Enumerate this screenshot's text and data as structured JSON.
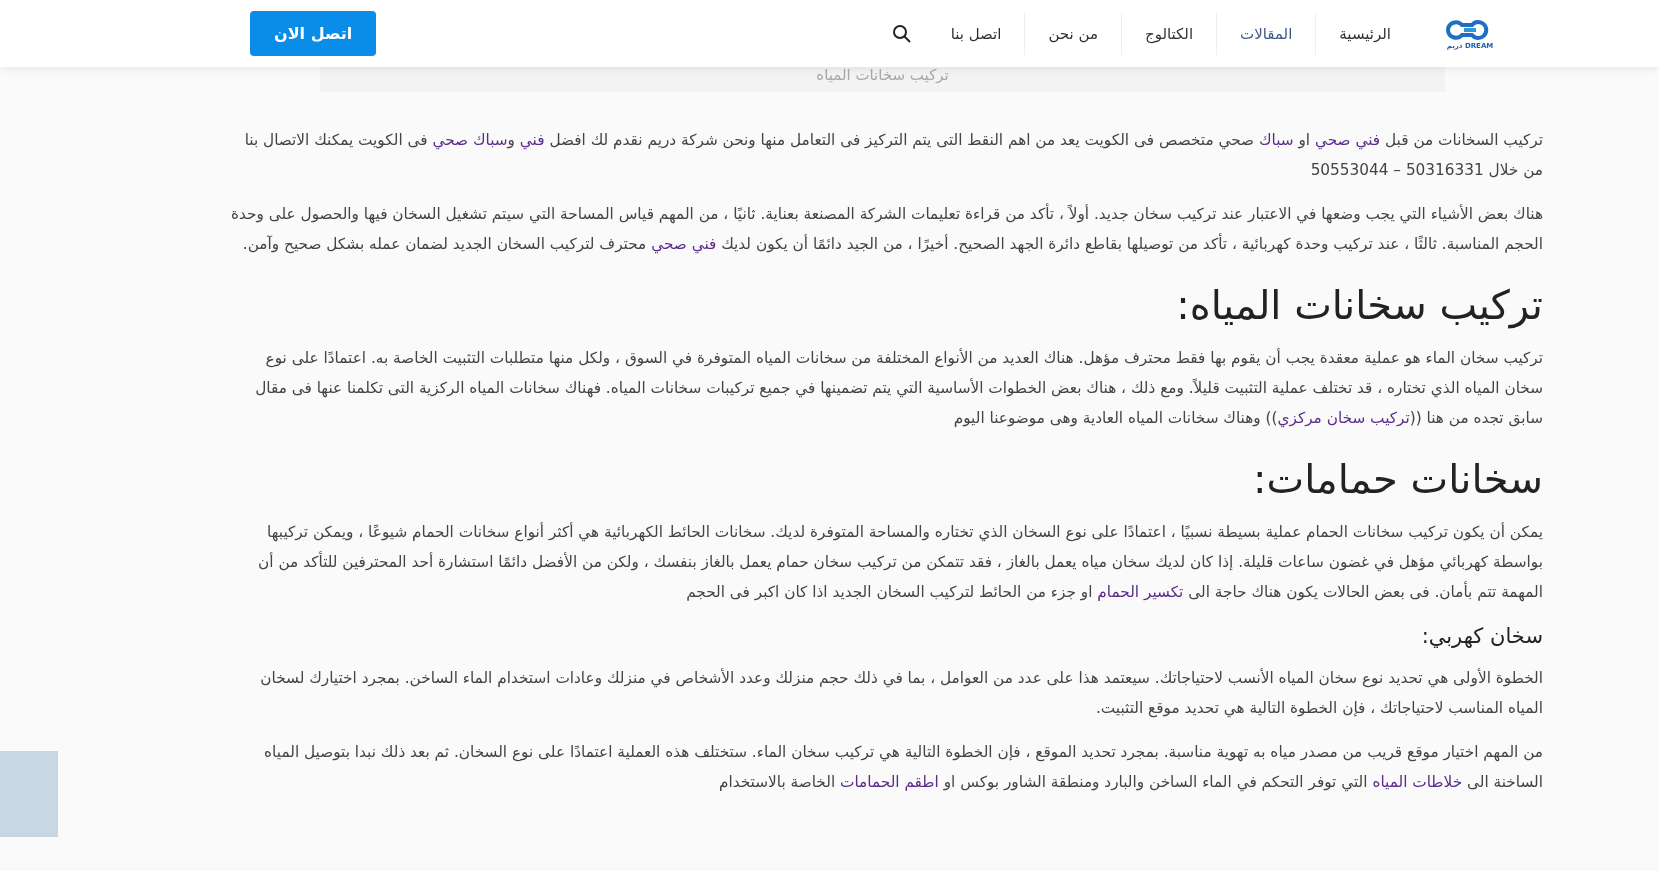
{
  "header": {
    "logo_text": "DREAM دريم",
    "nav": [
      {
        "label": "الرئيسية",
        "selected": false
      },
      {
        "label": "المقالات",
        "selected": true
      },
      {
        "label": "الكتالوج",
        "selected": false
      },
      {
        "label": "من نحن",
        "selected": false
      },
      {
        "label": "اتصل بنا",
        "selected": false
      }
    ],
    "cta": "اتصل الان"
  },
  "caption": "تركيب سخانات المياه",
  "blocks": [
    {
      "kind": "p",
      "segments": [
        {
          "text": "تركيب السخانات من قبل ",
          "link": false
        },
        {
          "text": "فني صحي",
          "link": true
        },
        {
          "text": " او ",
          "link": false
        },
        {
          "text": "سباك",
          "link": true
        },
        {
          "text": " صحي متخصص فى الكويت يعد من اهم النقط التى يتم التركيز فى التعامل منها ونحن شركة دريم نقدم لك افضل ",
          "link": false
        },
        {
          "text": "فني",
          "link": true
        },
        {
          "text": " و",
          "link": false
        },
        {
          "text": "سباك صحي",
          "link": true
        },
        {
          "text": " فى الكويت يمكنك الاتصال بنا من خلال 50316331 – 50553044",
          "link": false
        }
      ]
    },
    {
      "kind": "p",
      "segments": [
        {
          "text": "هناك بعض الأشياء التي يجب وضعها في الاعتبار عند تركيب سخان جديد. أولاً ، تأكد من قراءة تعليمات الشركة المصنعة بعناية. ثانيًا ، من المهم قياس المساحة التي سيتم تشغيل السخان فيها والحصول على وحدة الحجم المناسبة. ثالثًا ، عند تركيب وحدة كهربائية ، تأكد من توصيلها بقاطع دائرة الجهد الصحيح. أخيرًا ، من الجيد دائمًا أن يكون لديك ",
          "link": false
        },
        {
          "text": "فني صحي",
          "link": true
        },
        {
          "text": " محترف لتركيب السخان الجديد لضمان عمله بشكل صحيح وآمن.",
          "link": false
        }
      ]
    },
    {
      "kind": "h2",
      "segments": [
        {
          "text": "تركيب سخانات المياه:",
          "link": false
        }
      ]
    },
    {
      "kind": "p",
      "segments": [
        {
          "text": "تركيب سخان الماء هو عملية معقدة يجب أن يقوم بها فقط محترف مؤهل. هناك العديد من الأنواع المختلفة من سخانات المياه المتوفرة في السوق ، ولكل منها متطلبات التثبيت الخاصة به. اعتمادًا على نوع سخان المياه الذي تختاره ، قد تختلف عملية التثبيت قليلاً. ومع ذلك ، هناك بعض الخطوات الأساسية التي يتم تضمينها في جميع تركيبات سخانات المياه. فهناك سخانات المياه الركزية التى تكلمنا عنها فى مقال سابق تجده من هنا ((",
          "link": false
        },
        {
          "text": "تركيب سخان مركزي",
          "link": true
        },
        {
          "text": ")) وهناك سخانات المياه العادية وهى موضوعنا اليوم",
          "link": false
        }
      ]
    },
    {
      "kind": "h2",
      "segments": [
        {
          "text": "سخانات حمامات:",
          "link": false
        }
      ]
    },
    {
      "kind": "p",
      "segments": [
        {
          "text": "يمكن أن يكون تركيب سخانات الحمام عملية بسيطة نسبيًا ، اعتمادًا على نوع السخان الذي تختاره والمساحة المتوفرة لديك. سخانات الحائط الكهربائية هي أكثر أنواع سخانات الحمام شيوعًا ، ويمكن تركيبها بواسطة كهربائي مؤهل في غضون ساعات قليلة. إذا كان لديك سخان مياه يعمل بالغاز ، فقد تتمكن من تركيب سخان حمام يعمل بالغاز بنفسك ، ولكن من الأفضل دائمًا استشارة أحد المحترفين للتأكد من أن المهمة تتم بأمان. فى بعض الحالات يكون هناك حاجة الى ",
          "link": false
        },
        {
          "text": "تكسير الحمام",
          "link": true
        },
        {
          "text": " او جزء من الحائط لتركيب السخان الجديد اذا كان اكبر فى الحجم",
          "link": false
        }
      ]
    },
    {
      "kind": "h3",
      "segments": [
        {
          "text": "سخان كهربي:",
          "link": false
        }
      ]
    },
    {
      "kind": "p",
      "segments": [
        {
          "text": "الخطوة الأولى هي تحديد نوع سخان المياه الأنسب لاحتياجاتك. سيعتمد هذا على عدد من العوامل ، بما في ذلك حجم منزلك وعدد الأشخاص في منزلك وعادات استخدام الماء الساخن. بمجرد اختيارك لسخان المياه المناسب لاحتياجاتك ، فإن الخطوة التالية هي تحديد موقع التثبيت.",
          "link": false
        }
      ]
    },
    {
      "kind": "p",
      "segments": [
        {
          "text": "من المهم اختيار موقع قريب من مصدر مياه به تهوية مناسبة. بمجرد تحديد الموقع ، فإن الخطوة التالية هي تركيب سخان الماء. ستختلف هذه العملية اعتمادًا على نوع السخان. ثم بعد ذلك نبدا بتوصيل المياه الساخنة الى ",
          "link": false
        },
        {
          "text": "خلاطات المياه",
          "link": true
        },
        {
          "text": " التي توفر التحكم في الماء الساخن والبارد ومنطقة الشاور بوكس او ",
          "link": false
        },
        {
          "text": "اطقم الحمامات",
          "link": true
        },
        {
          "text": " الخاصة بالاستخدام",
          "link": false
        }
      ]
    }
  ]
}
